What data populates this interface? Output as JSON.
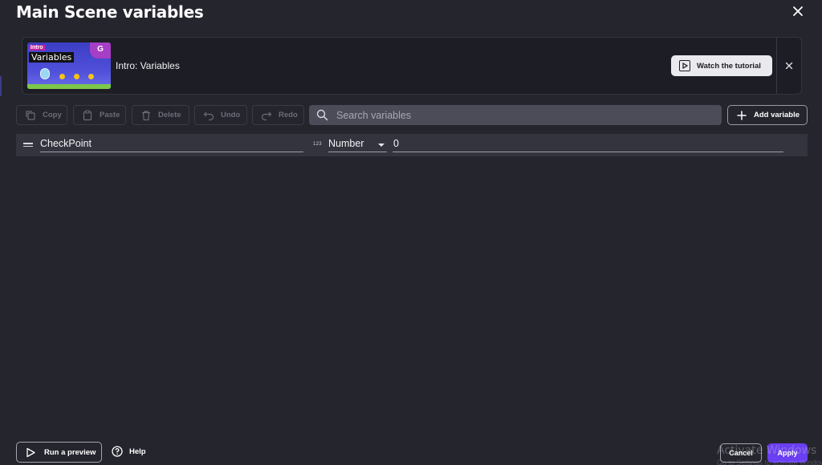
{
  "dialog": {
    "title": "Main Scene variables"
  },
  "tutorial": {
    "thumbnail_tag": "Intro",
    "thumbnail_label": "Variables",
    "thumbnail_logo": "G",
    "title": "Intro: Variables",
    "watch_label": "Watch the tutorial"
  },
  "toolbar": {
    "copy_label": "Copy",
    "paste_label": "Paste",
    "delete_label": "Delete",
    "undo_label": "Undo",
    "redo_label": "Redo",
    "search_placeholder": "Search variables",
    "add_label": "Add variable"
  },
  "variables": [
    {
      "name": "CheckPoint",
      "type_icon": "123",
      "type": "Number",
      "value": "0"
    }
  ],
  "footer": {
    "run_preview_label": "Run a preview",
    "help_label": "Help",
    "cancel_label": "Cancel",
    "apply_label": "Apply"
  },
  "watermark": {
    "line1": "Activate Windows",
    "line2": "Go to Settings to activate Windows."
  },
  "colors": {
    "accent": "#6a3ef2",
    "background": "#25252e",
    "row": "#34343e"
  },
  "icons": [
    "close-icon",
    "play-icon",
    "copy-icon",
    "paste-icon",
    "delete-icon",
    "undo-icon",
    "redo-icon",
    "search-icon",
    "plus-icon",
    "drag-handle-icon",
    "help-icon"
  ]
}
